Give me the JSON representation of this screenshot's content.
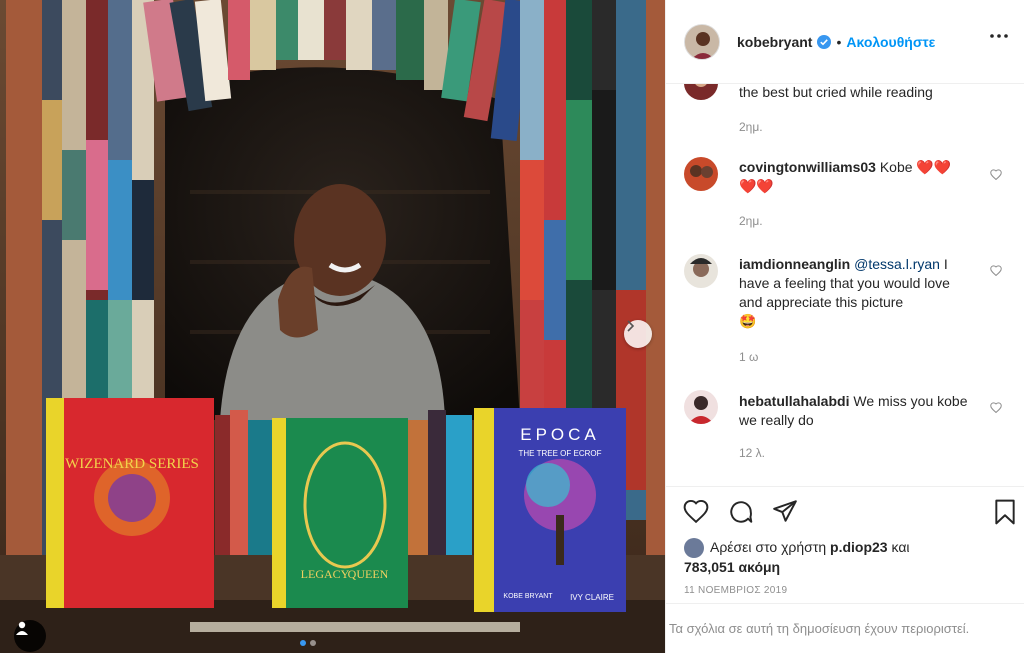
{
  "post": {
    "username": "kobebryant",
    "follow_label": "Ακολουθήστε",
    "separator": "•",
    "photo_alt": "Man smiling in a window framed by books, with books Wizenard Series, Legacy and the Queen, Epoca The Tree of Ecrof",
    "book_titles": [
      "WIZENARD SERIES",
      "LEGACY",
      "QUEEN",
      "EPOCA",
      "THE TREE OF ECROF",
      "KOBE BRYANT",
      "IVY CLAIRE"
    ],
    "carousel_count": 2,
    "carousel_active": 0
  },
  "comments": [
    {
      "username": "",
      "text": "the best but cried while reading",
      "time": "2ημ.",
      "heart": false
    },
    {
      "username": "covingtonwilliams03",
      "text": " Kobe ",
      "time": "2ημ.",
      "heart": true
    },
    {
      "username": "iamdionneanglin",
      "mention": "@tessa.l.ryan",
      "text": " I have a feeling that you would love and appreciate this picture",
      "time": "1 ω",
      "heart": true
    },
    {
      "username": "hebatullahalabdi",
      "text": " We miss you kobe we really do",
      "time": "12 λ.",
      "heart": true
    }
  ],
  "actions": {
    "likes_prefix": "Αρέσει στο χρήστη ",
    "likes_user": "p.diop23",
    "likes_and": " και",
    "likes_count": "783,051 ακόμη",
    "date": "11 ΝΟΕΜΒΡΙΟΣ 2019"
  },
  "comments_disabled": "Τα σχόλια σε αυτή τη δημοσίευση έχουν περιοριστεί.",
  "colors": {
    "accent": "#0095f6",
    "heart_red": "#ed4956",
    "verified": "#3897f0"
  },
  "icons": [
    "heart-icon",
    "comment-icon",
    "share-icon",
    "bookmark-icon",
    "more-icon",
    "verified-icon",
    "chevron-right-icon",
    "user-tag-icon"
  ]
}
